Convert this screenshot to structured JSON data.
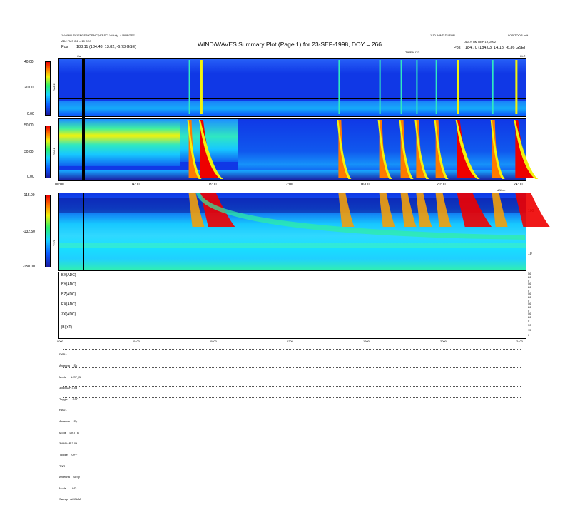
{
  "header": {
    "left_line1": "1=WIND SCIENCE/MOSAIC(W3 SC) W/fully -> WUFGSE",
    "left_line2": "ADJ FMS 2.2 × 10 SEC",
    "left_pos_label": "Pos",
    "left_pos": "183.11 (184.48, 13.82, -6.73 GSE)",
    "title": "WIND/WAVES Summary Plot (Page 1) for 23-SEP-1998, DOY = 266",
    "right_line1": "1.10 WIND DUFOR",
    "right_line1b": "LOB/TOOR edit",
    "right_line2": "DAILY TIM DEP 19, 2002",
    "right_pos_label": "Pos",
    "right_pos": "184.70 (184.03, 14.18, -6.36 GSE)",
    "right_unit_top": "Ki-Z"
  },
  "rad2": {
    "ylabel": "RAD2",
    "ticks": [
      "40.00",
      "20.00",
      "0.00"
    ],
    "cal_label": "Cal"
  },
  "rad1": {
    "ylabel": "RAD1",
    "ticks": [
      "50.00",
      "30.00",
      "0.00"
    ],
    "xticks": [
      "00:00",
      "04:00",
      "08:00",
      "12:00",
      "16:00",
      "20:00",
      "24:00"
    ]
  },
  "tnr": {
    "ylabel": "TNR",
    "ticks": [
      "-115.00",
      "-132.50",
      "-150.00"
    ],
    "right_ticks": [
      "100",
      "10"
    ],
    "right_label": "dB/cm"
  },
  "time_labels": {
    "top": "TIMEAUTC",
    "bottom": [
      "0000",
      "0400",
      "0800",
      "1200",
      "1600",
      "2000",
      "2400"
    ]
  },
  "line_panels": [
    {
      "label": "BX(ADC)",
      "ticks": [
        "56",
        "26",
        "0"
      ]
    },
    {
      "label": "BY(ADC)",
      "ticks": [
        "56",
        "26",
        "0"
      ]
    },
    {
      "label": "BZ(ADC)",
      "ticks": [
        "56",
        "26",
        "0"
      ]
    },
    {
      "label": "EX(ADC)",
      "ticks": [
        "56",
        "26",
        "0"
      ]
    },
    {
      "label": "ZX(ADC)",
      "ticks": [
        "56",
        "26",
        "0"
      ]
    },
    {
      "label": "|B|(nT)",
      "ticks": [
        "30",
        "15",
        "0"
      ]
    }
  ],
  "legend": {
    "lines": [
      "RAD1",
      "Antenna     Sy",
      "Mode      LIST_B",
      "3dB/DAP 3.0d",
      "Toggle      OFF",
      "RAD1",
      "Antenna     Sy",
      "Mode    LIST_B",
      "3dB/DAP 3.0d",
      "Toggle     OFF",
      "TNR",
      "Antenna    SuSy",
      "Mode       A/D",
      "Sweep   ACCUM"
    ]
  },
  "chart_data": {
    "type": "heatmap",
    "title": "WIND/WAVES Summary Plot (Page 1) for 23-SEP-1998, DOY = 266",
    "x_range_hours": [
      0,
      24
    ],
    "x_ticks": [
      "00:00",
      "04:00",
      "08:00",
      "12:00",
      "16:00",
      "20:00",
      "24:00"
    ],
    "panels": [
      {
        "name": "RAD2",
        "ylim": [
          0,
          40
        ]
      },
      {
        "name": "RAD1",
        "ylim": [
          0,
          50
        ]
      },
      {
        "name": "TNR",
        "ylim": [
          -150,
          -115
        ]
      }
    ],
    "bursts_hours": [
      6.7,
      7.3,
      14.4,
      16.5,
      17.6,
      18.4,
      19.4,
      20.5,
      22.3,
      23.5
    ],
    "major_burst_hours": [
      7.3,
      20.5,
      23.5
    ],
    "colors": {
      "low": "#1a1aa0",
      "mid": "#17d4ff",
      "high": "#ee0000",
      "background": "#1038e6"
    }
  }
}
